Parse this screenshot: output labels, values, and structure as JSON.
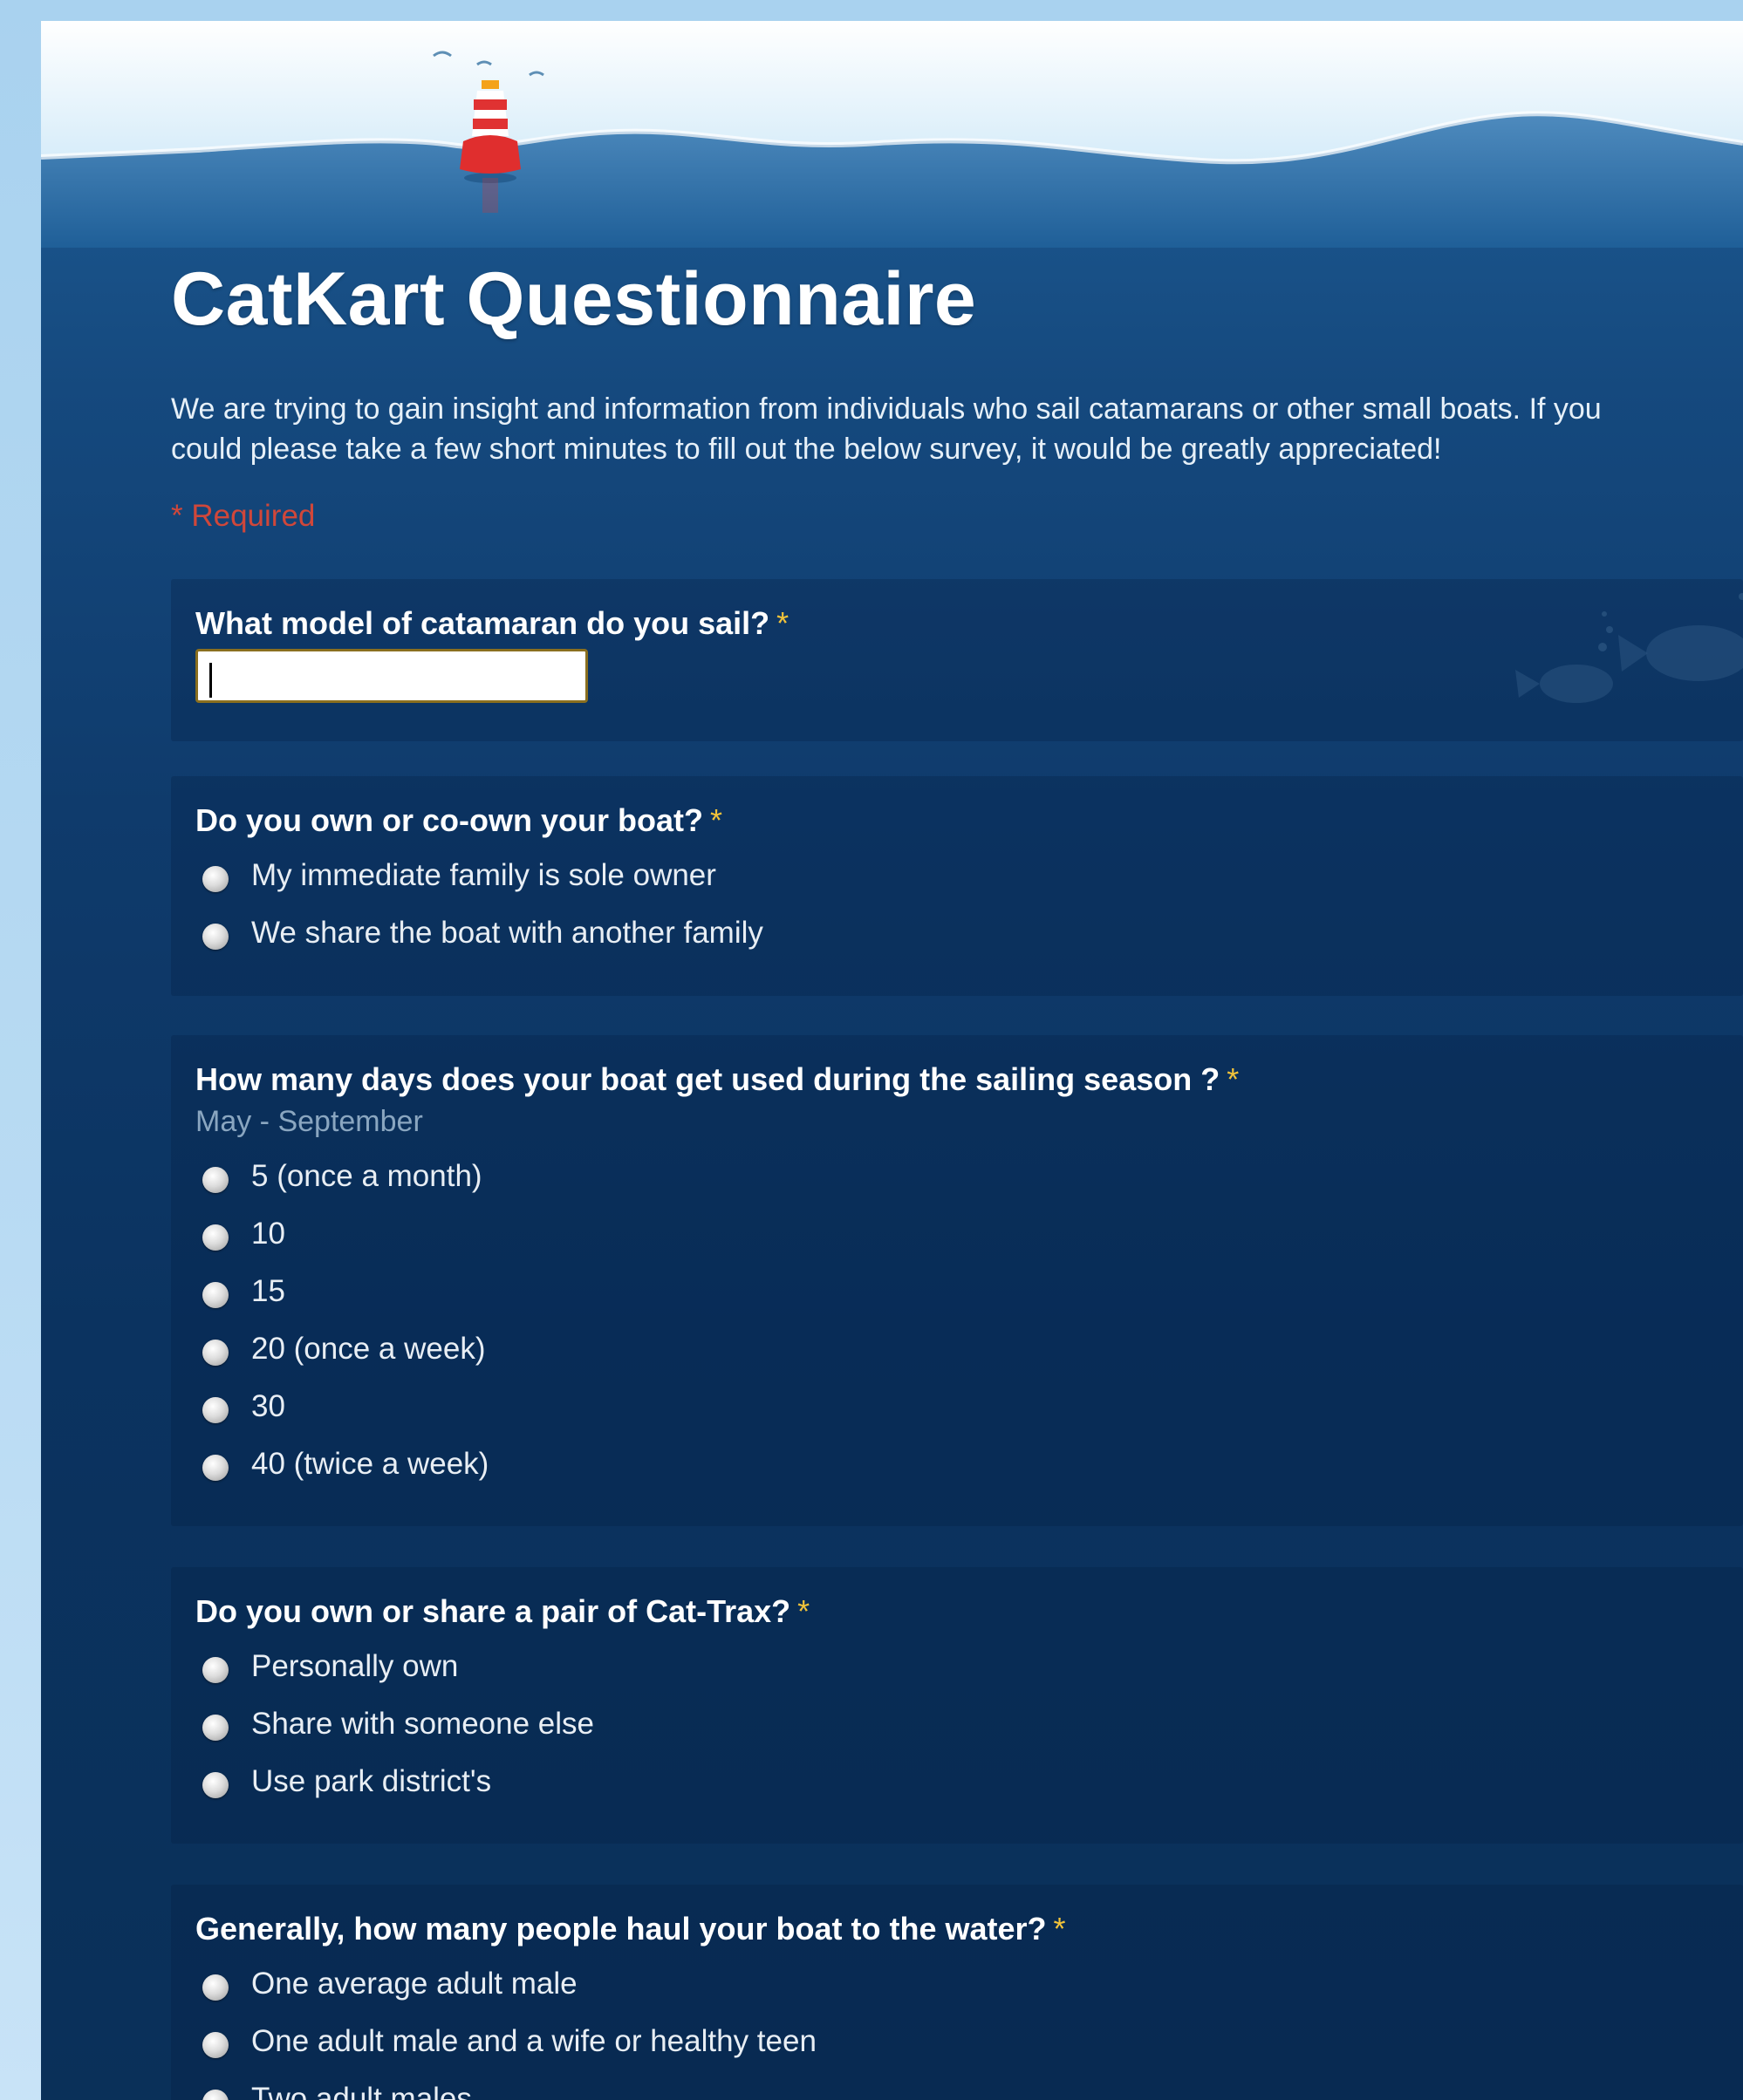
{
  "form": {
    "title": "CatKart Questionnaire",
    "description_line1": "We are trying to gain insight and information from individuals who sail catamarans or other small boats.  If you",
    "description_line2": "could please take a few short minutes to fill out the below survey, it would be greatly appreciated!",
    "required_note": "* Required"
  },
  "questions": [
    {
      "title": "What model of catamaran do you sail?",
      "required_marker": "*",
      "input_value": ""
    },
    {
      "title": "Do you own or co-own your boat?",
      "required_marker": "*",
      "options": [
        "My immediate family is sole owner",
        "We share the boat with another family"
      ]
    },
    {
      "title": "How many days does your boat get used during the sailing season ?",
      "required_marker": "*",
      "help": "May - September",
      "options": [
        "5 (once a month)",
        "10",
        "15",
        "20 (once a week)",
        "30",
        "40 (twice a week)"
      ]
    },
    {
      "title": "Do you own or share a pair of Cat-Trax?",
      "required_marker": "*",
      "options": [
        "Personally own",
        "Share with someone else",
        "Use park district's"
      ]
    },
    {
      "title": "Generally, how many people haul your boat to the water?",
      "required_marker": "*",
      "options": [
        "One average adult male",
        "One adult male and a wife or healthy teen",
        "Two adult males"
      ]
    }
  ],
  "colors": {
    "water_top": "#1f5f98",
    "water_bottom": "#0a3059",
    "required_red": "#d0473a",
    "required_star": "#f2c33a",
    "help_text": "#8aa6c0"
  },
  "icons": [
    "buoy-icon",
    "fish-icon",
    "radio-button"
  ]
}
